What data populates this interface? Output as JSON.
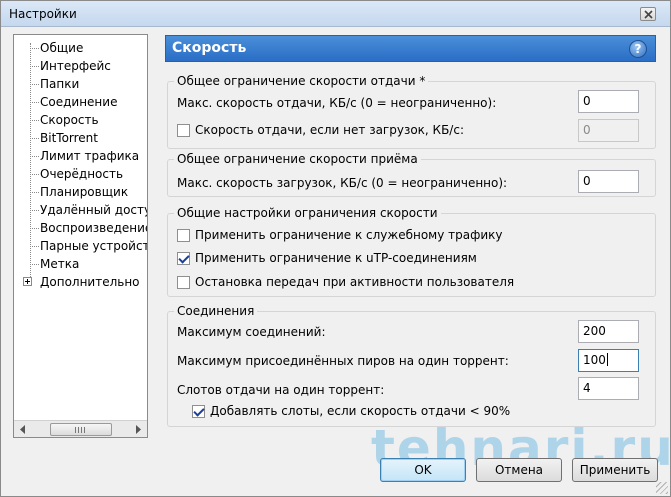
{
  "window": {
    "title": "Настройки"
  },
  "tree": {
    "items": [
      {
        "label": "Общие"
      },
      {
        "label": "Интерфейс"
      },
      {
        "label": "Папки"
      },
      {
        "label": "Соединение"
      },
      {
        "label": "Скорость",
        "selected": true
      },
      {
        "label": "BitTorrent"
      },
      {
        "label": "Лимит трафика"
      },
      {
        "label": "Очерёдность"
      },
      {
        "label": "Планировщик"
      },
      {
        "label": "Удалённый доступ"
      },
      {
        "label": "Воспроизведение"
      },
      {
        "label": "Парные устройства"
      },
      {
        "label": "Метка"
      },
      {
        "label": "Дополнительно",
        "expandable": true
      }
    ]
  },
  "panel": {
    "title": "Скорость"
  },
  "upload_group": {
    "legend": "Общее ограничение скорости отдачи *",
    "max_label": "Макс. скорость отдачи, КБ/с (0 = неограниченно):",
    "max_value": "0",
    "no_downloads_label": "Скорость отдачи, если нет загрузок, КБ/с:",
    "no_downloads_checked": false,
    "no_downloads_value": "0"
  },
  "download_group": {
    "legend": "Общее ограничение скорости приёма",
    "max_label": "Макс. скорость загрузок, КБ/с (0 = неограниченно):",
    "max_value": "0"
  },
  "limits_group": {
    "legend": "Общие настройки ограничения скорости",
    "options": [
      {
        "label": "Применить ограничение к служебному трафику",
        "checked": false
      },
      {
        "label": "Применить ограничение к uTP-соединениям",
        "checked": true
      },
      {
        "label": "Остановка передач при активности пользователя",
        "checked": false
      }
    ]
  },
  "connections_group": {
    "legend": "Соединения",
    "max_connections_label": "Максимум соединений:",
    "max_connections_value": "200",
    "max_peers_label": "Максимум присоединённых пиров на один торрент:",
    "max_peers_value": "100",
    "upload_slots_label": "Слотов отдачи на один торрент:",
    "upload_slots_value": "4",
    "extra_slots_label": "Добавлять слоты, если скорость отдачи < 90%",
    "extra_slots_checked": true
  },
  "buttons": {
    "ok": "OK",
    "cancel": "Отмена",
    "apply": "Применить"
  },
  "watermark": "tehnari.ru"
}
